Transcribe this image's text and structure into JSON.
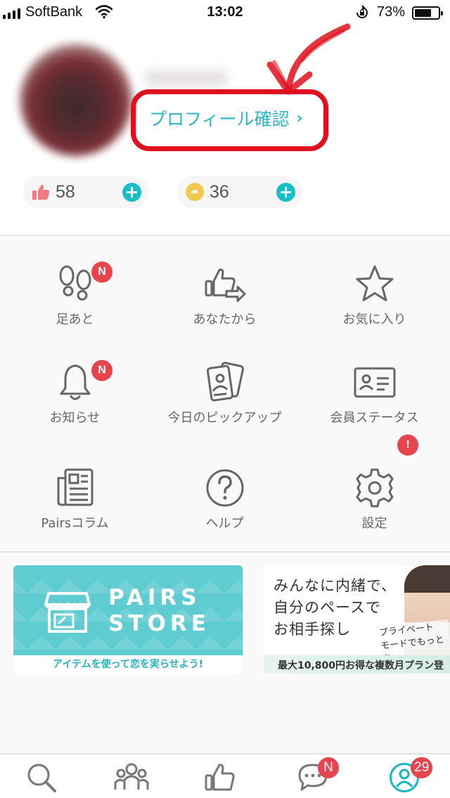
{
  "status_bar": {
    "carrier": "SoftBank",
    "time": "13:02",
    "battery_percent": "73%",
    "battery_level": 0.73,
    "icons": [
      "signal-icon",
      "wifi-icon",
      "orientation-lock-icon",
      "battery-icon"
    ]
  },
  "profile": {
    "confirm_link": "プロフィール確認",
    "chevron": "›",
    "annotation_color": "#e0101e"
  },
  "counters": {
    "likes": {
      "value": "58",
      "icon": "thumbs-up-icon",
      "color": "#f07c83"
    },
    "points": {
      "value": "36",
      "icon": "coin-icon",
      "color": "#f2c94c"
    },
    "plus_symbol": "+"
  },
  "menu": {
    "items": [
      {
        "label": "足あと",
        "icon": "footprints-icon",
        "badge": "N"
      },
      {
        "label": "あなたから",
        "icon": "sent-like-icon",
        "badge": ""
      },
      {
        "label": "お気に入り",
        "icon": "star-icon",
        "badge": ""
      },
      {
        "label": "お知らせ",
        "icon": "bell-icon",
        "badge": "N"
      },
      {
        "label": "今日のピックアップ",
        "icon": "pickup-cards-icon",
        "badge": ""
      },
      {
        "label": "会員ステータス",
        "icon": "member-card-icon",
        "badge": ""
      },
      {
        "label": "Pairsコラム",
        "icon": "newspaper-icon",
        "badge": ""
      },
      {
        "label": "ヘルプ",
        "icon": "help-icon",
        "badge": ""
      },
      {
        "label": "設定",
        "icon": "gear-icon",
        "badge": "!"
      }
    ]
  },
  "banners": {
    "store": {
      "title_line1": "PAIRS",
      "title_line2": "STORE",
      "caption": "アイテムを使って恋を実らせよう!",
      "color": "#5fccd2"
    },
    "private_mode": {
      "line1": "みんなに内緒で、",
      "line2": "自分のペースで",
      "line3": "お相手探し",
      "tagline1": "プライベート",
      "tagline2": "モードでもっと安",
      "strip": "最大10,800円お得な複数月プラン登"
    }
  },
  "bottom_nav": {
    "items": [
      {
        "icon": "search-icon",
        "badge": ""
      },
      {
        "icon": "community-icon",
        "badge": ""
      },
      {
        "icon": "like-icon",
        "badge": ""
      },
      {
        "icon": "messages-icon",
        "badge": "N"
      },
      {
        "icon": "profile-icon",
        "badge": "29",
        "active": true
      }
    ],
    "accent": "#17b8c3"
  }
}
